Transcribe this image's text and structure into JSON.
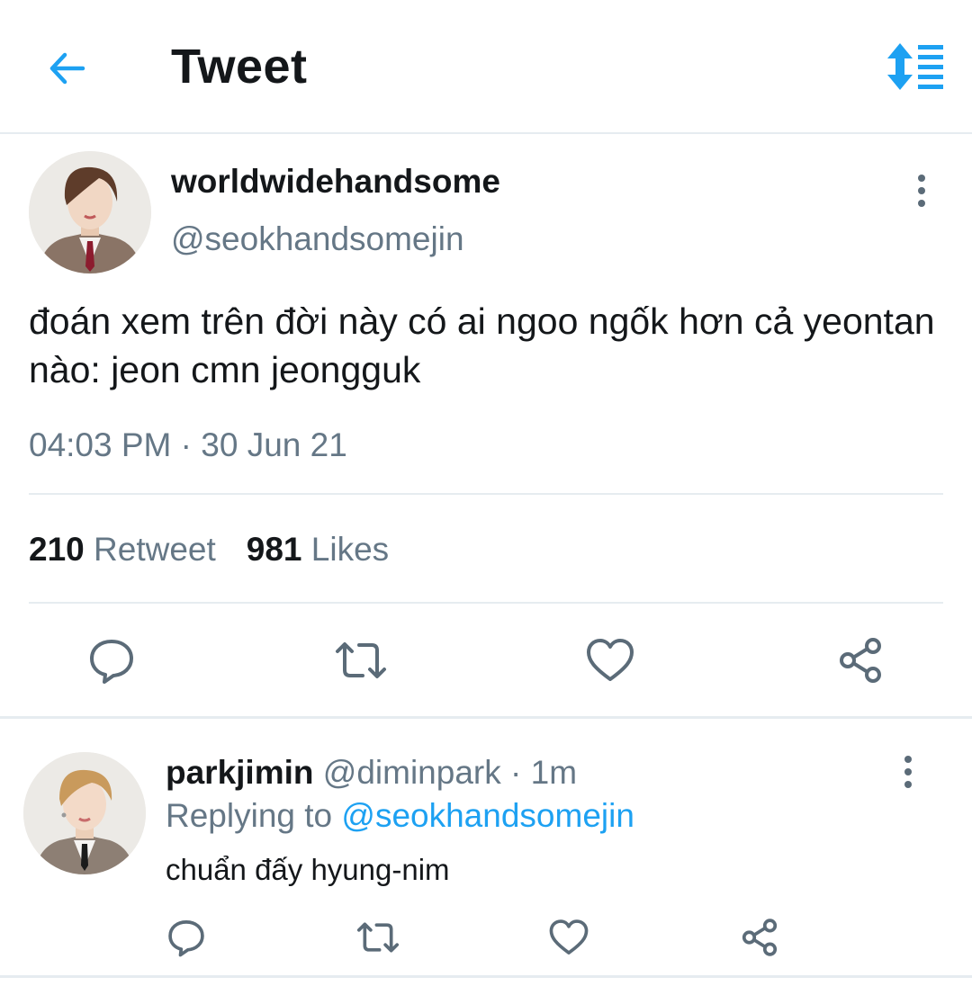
{
  "header": {
    "title": "Tweet",
    "back_icon": "arrow-left-icon",
    "sort_icon": "sort-list-icon",
    "accent": "#1da1f2"
  },
  "tweet": {
    "display_name": "worldwidehandsome",
    "handle": "@seokhandsomejin",
    "text": "đoán xem trên đời này có ai ngoo ngốk hơn cả yeontan nào: jeon cmn jeongguk",
    "time": "04:03 PM",
    "date": "30 Jun 21",
    "retweet_count": "210",
    "retweet_label": "Retweet",
    "like_count": "981",
    "like_label": "Likes",
    "actions": [
      "reply-icon",
      "retweet-icon",
      "like-icon",
      "share-icon"
    ]
  },
  "reply": {
    "display_name": "parkjimin",
    "handle": "@diminpark",
    "time_ago": "1m",
    "replying_label": "Replying to",
    "replying_to": "@seokhandsomejin",
    "text": "chuẩn đấy hyung-nim"
  },
  "colors": {
    "secondary_text": "#657786",
    "icon": "#5b6b78",
    "divider": "#e6ecf0"
  }
}
